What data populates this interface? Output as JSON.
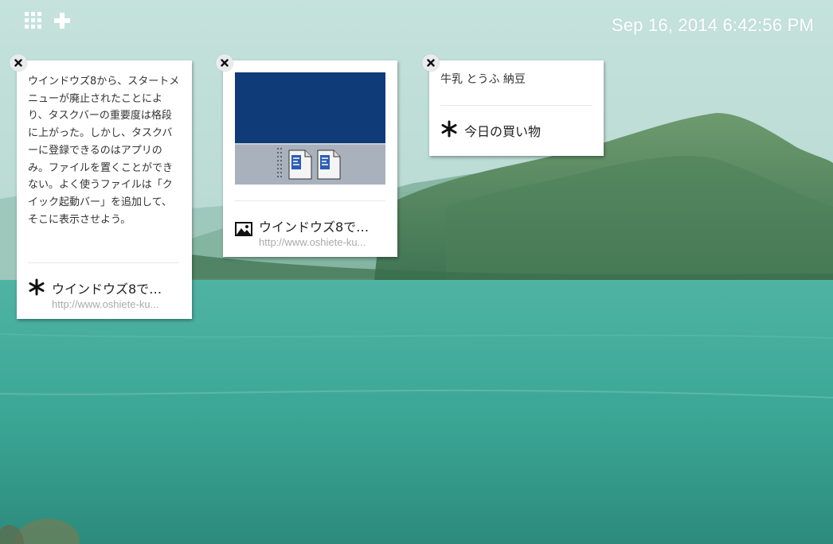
{
  "topbar": {
    "apps_icon": "grid-icon",
    "add_icon": "plus-icon",
    "clock": "Sep 16, 2014 6:42:56 PM"
  },
  "cards": [
    {
      "type": "text",
      "close_icon": "close-icon",
      "text": "ウインドウズ8から、スタートメニューが廃止されたことにより、タスクバーの重要度は格段に上がった。しかし、タスクバーに登録できるのはアプリのみ。ファイルを置くことができない。よく使うファイルは「クイック起動バー」を追加して、そこに表示させよう。",
      "link_icon": "asterisk-icon",
      "link_title": "ウインドウズ8で…",
      "link_url": "http://www.oshiete-ku..."
    },
    {
      "type": "image",
      "close_icon": "close-icon",
      "image_icon": "taskbar-screenshot",
      "link_icon": "image-icon",
      "link_title": "ウインドウズ8で…",
      "link_url": "http://www.oshiete-ku..."
    },
    {
      "type": "memo",
      "close_icon": "close-icon",
      "text": "牛乳 とうふ 納豆",
      "tag_icon": "asterisk-icon",
      "tag_label": "今日の買い物"
    }
  ],
  "colors": {
    "card_bg": "#ffffff",
    "thumb_blue": "#0f3b78",
    "thumb_gray": "#a9b1bd",
    "text": "#333333",
    "url": "#aaaaaa"
  }
}
